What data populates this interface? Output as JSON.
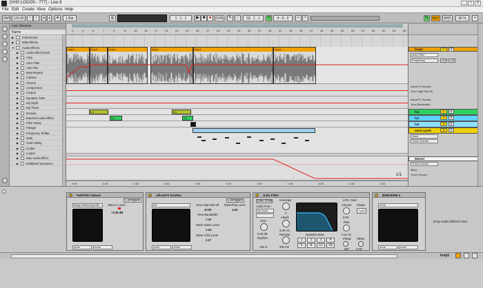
{
  "window": {
    "title": "[VHS LOGOS - 777] - Live 8",
    "min": "_",
    "max": "□",
    "close": "X"
  },
  "menu": [
    "File",
    "Edit",
    "Create",
    "View",
    "Options",
    "Help"
  ],
  "transport": {
    "tap": "TAP",
    "tempo": "120.00",
    "meter_num": "4",
    "meter_den": "4",
    "quantize": "1 Bar",
    "ovr": "OVR",
    "position": "1 . 1 . 1",
    "loop_start": "33 . 1 . 1",
    "loop_len": "4 . 0 . 0",
    "key": "KEY",
    "midi": "MIDI",
    "cpu": "36 %",
    "d_label": "D"
  },
  "browser": {
    "title": "Live Devices",
    "column_name": "Name",
    "items": [
      {
        "label": "Instruments",
        "level": 0,
        "type": "folder",
        "open": false
      },
      {
        "label": "MIDI Effects",
        "level": 0,
        "type": "folder",
        "open": false
      },
      {
        "label": "Audio Effects",
        "level": 0,
        "type": "folder",
        "open": true
      },
      {
        "label": "Audio Effect Rack",
        "level": 1,
        "type": "device"
      },
      {
        "label": "Amp",
        "level": 1,
        "type": "device"
      },
      {
        "label": "Auto Filter",
        "level": 1,
        "type": "device"
      },
      {
        "label": "Auto Pan",
        "level": 1,
        "type": "device"
      },
      {
        "label": "Beat Repeat",
        "level": 1,
        "type": "device"
      },
      {
        "label": "Cabinet",
        "level": 1,
        "type": "device"
      },
      {
        "label": "Chorus",
        "level": 1,
        "type": "device"
      },
      {
        "label": "Compressor",
        "level": 1,
        "type": "device"
      },
      {
        "label": "Corpus",
        "level": 1,
        "type": "device"
      },
      {
        "label": "Dynamic Tube",
        "level": 1,
        "type": "device"
      },
      {
        "label": "EQ Eight",
        "level": 1,
        "type": "device"
      },
      {
        "label": "EQ Three",
        "level": 1,
        "type": "device"
      },
      {
        "label": "Erosion",
        "level": 1,
        "type": "device"
      },
      {
        "label": "External Audio Effect",
        "level": 1,
        "type": "device"
      },
      {
        "label": "Filter Delay",
        "level": 1,
        "type": "device"
      },
      {
        "label": "Flanger",
        "level": 1,
        "type": "device"
      },
      {
        "label": "Frequency Shifter",
        "level": 1,
        "type": "device"
      },
      {
        "label": "Gate",
        "level": 1,
        "type": "device"
      },
      {
        "label": "Grain Delay",
        "level": 1,
        "type": "device"
      },
      {
        "label": "Limiter",
        "level": 1,
        "type": "device"
      },
      {
        "label": "Looper",
        "level": 1,
        "type": "device"
      },
      {
        "label": "Max Audio Effect",
        "level": 1,
        "type": "device"
      },
      {
        "label": "Multiband Dynamics",
        "level": 1,
        "type": "device"
      }
    ]
  },
  "ruler": {
    "bars": [
      "1",
      "3",
      "5",
      "7",
      "9",
      "11",
      "13",
      "15",
      "17",
      "19",
      "21",
      "23",
      "25",
      "27",
      "29",
      "31",
      "33",
      "35",
      "37",
      "39",
      "41",
      "43",
      "45",
      "47",
      "49",
      "51",
      "53",
      "55",
      "57",
      "59",
      "61",
      "63",
      "65"
    ],
    "time": [
      "0:00",
      "0:15",
      "0:30",
      "0:45",
      "1:00",
      "1:15",
      "1:30",
      "1:45",
      "2:00",
      "2:15",
      "2:30"
    ],
    "zoom": "1/1"
  },
  "clips": {
    "loop": "loop1",
    "fx1": "fx1",
    "fx2": "fx2"
  },
  "tracks": [
    {
      "name": "loop1",
      "color": "#f0a000",
      "p1": "Auto Filter",
      "p2": "Frequency",
      "l1": "siliumFX Sonitec",
      "l2": "Tone High Roll-off",
      "l3": "siliumFX Sonitec",
      "l4": "Tone Bandwidth",
      "num": "1",
      "s": "S",
      "inf": "-inf"
    },
    {
      "name": "fx1",
      "color": "#2fd060",
      "num": "2",
      "s": "S"
    },
    {
      "name": "fx2",
      "color": "#5fd3ff",
      "num": "3",
      "s": "S"
    },
    {
      "name": "fx3",
      "color": "#8fe0ff",
      "num": "4",
      "s": "S"
    },
    {
      "name": "omni synth",
      "color": "#f0d000",
      "p1": "None",
      "p2": "Track Volume",
      "num": "5",
      "s": "S"
    },
    {
      "name": "Master",
      "color": "#ffffff",
      "p1": "Track Volume",
      "l1": "Mixer",
      "l2": "Track Volume"
    }
  ],
  "devices": [
    {
      "title": "FabFilter Saturn",
      "configure": "Configure",
      "preset": "Magic Mastering Mill",
      "param": "Band 1 Level",
      "value": "+3.38 dB",
      "none1": "none",
      "none2": "none"
    },
    {
      "title": "siliumFX Sonitec",
      "configure": "Configure",
      "preset": "init",
      "p1": "Tone High Roll-off",
      "v1": "10.00",
      "p2": "Noise/Pop Level",
      "v2": "1.63",
      "p3": "Tone Bandwidth",
      "v3": "7.23",
      "p4": "Noise Noise Level",
      "v4": "1.16",
      "p5": "Noise Click Level",
      "v5": "2.17",
      "none1": "none",
      "none2": "none"
    },
    {
      "title": "Auto Filter",
      "sidechain": "Side-chain",
      "from_label": "Audio From",
      "from_value": "No Input",
      "gain": "Gain",
      "gain_val": "0.00 dB",
      "drywet": "Dry/Wet",
      "drywet_val": "100 %",
      "envelope": "Envelope",
      "env_val": "0",
      "attack": "Attack",
      "attack_val": "6.00 ms",
      "release": "Release",
      "release_val": "200 ms",
      "quantize": "Quantize Beat",
      "qvals": [
        "1",
        "2",
        "3",
        "4",
        "6",
        "8",
        "12",
        "16"
      ],
      "lfo": "LFO / S&H",
      "amount": "Amount",
      "amount_val": "0.00",
      "shape": "Shape",
      "rate": "Rate",
      "rate_val": "0.11 Hz",
      "phase": "Phase",
      "phase_val": "180°",
      "offset": "Offset",
      "offset_val": "0.00°"
    },
    {
      "title": "BREVERB 2",
      "preset": "none",
      "none1": "none",
      "none2": "none"
    }
  ],
  "drop_text": "Drop Audio Effects Here",
  "status": {
    "track": "loop1"
  }
}
